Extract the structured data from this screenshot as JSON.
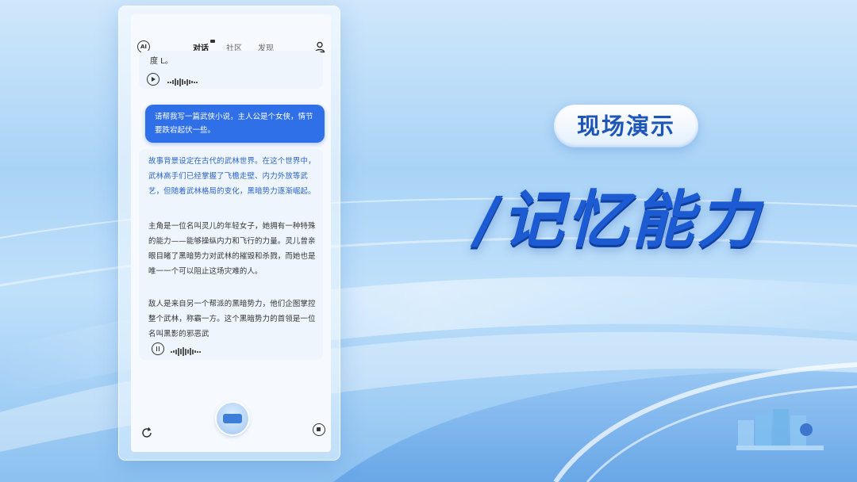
{
  "header": {
    "logo_text": "AI",
    "tabs": [
      {
        "label": "对话",
        "active": true
      },
      {
        "label": "社区",
        "active": false
      },
      {
        "label": "发现",
        "active": false
      }
    ]
  },
  "chat": {
    "previous_tail": "度 L。",
    "user_message": "请帮我写一篇武侠小说，主人公是个女侠，情节要跌宕起伏一些。",
    "answer_paragraphs": [
      "故事背景设定在古代的武林世界。在这个世界中，武林高手们已经掌握了飞檐走壁、内力外放等武艺，但随着武林格局的变化，黑暗势力逐渐崛起。",
      "主角是一位名叫灵儿的年轻女子，她拥有一种特殊的能力——能够操纵内力和飞行的力量。灵儿曾亲眼目睹了黑暗势力对武林的摧毁和杀戮，而她也是唯一一个可以阻止这场灾难的人。",
      "敌人是来自另一个帮派的黑暗势力，他们企图掌控整个武林，称霸一方。这个黑暗势力的首领是一位名叫黑影的邪恶武"
    ]
  },
  "slide": {
    "badge": "现场演示",
    "title": "/记忆能力"
  },
  "colors": {
    "accent": "#2f6fe8",
    "title_blue": "#1d5bd2"
  }
}
